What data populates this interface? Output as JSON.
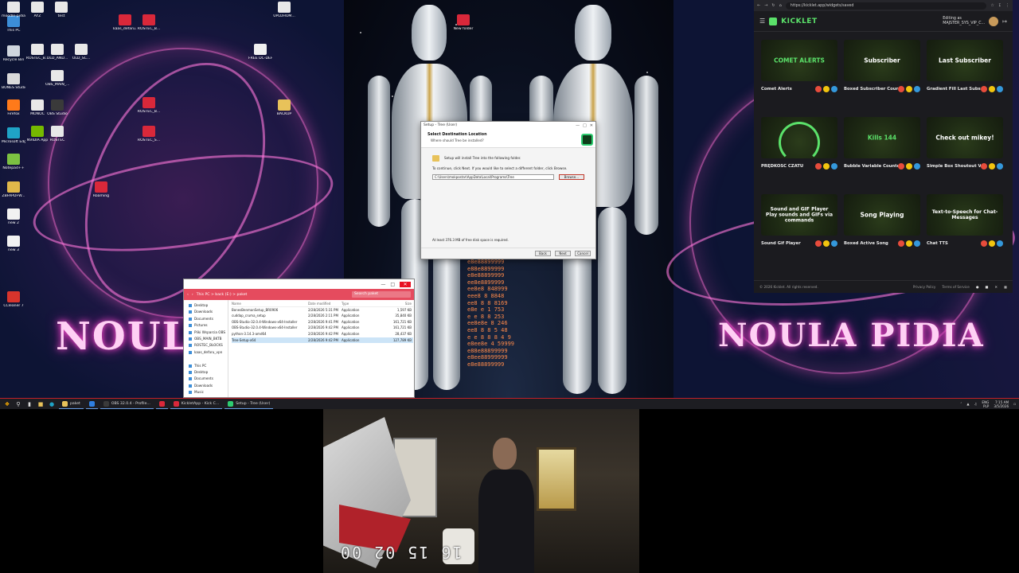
{
  "desktop": {
    "wall_text_left": "NOULA",
    "wall_text_right": "NOULA PIDIA",
    "matrix_lines": [
      "e8e88899999",
      "e88e8899999",
      "e8e88899999",
      "ee8e8899999",
      "ee8e8 848999",
      "eee8 8 8848",
      "ee8 8 8 8169",
      "e8e e 1 753",
      "e e 8 8 253",
      "ee8e8e 8 246",
      "ee8 8 8 5 48",
      "e e 8 8 8 4 9",
      "e8ee8e 4 59999",
      "e88e88899999",
      "e8ee88999999",
      "e8e88899999"
    ],
    "icons": [
      {
        "label": "This PC",
        "color": "#3c8ed8"
      },
      {
        "label": "Recycle Bin",
        "color": "#cfd6de"
      },
      {
        "label": "BONES Studio",
        "color": "#d9d9d9"
      },
      {
        "label": "Firefox",
        "color": "#ff7a1a"
      },
      {
        "label": "Microsoft Edge",
        "color": "#1fa3c6"
      },
      {
        "label": "Notepad++",
        "color": "#7cc242"
      },
      {
        "label": "ZBFAPDFW...",
        "color": "#e0b84a"
      },
      {
        "label": "new 2",
        "color": "#f2f2f2"
      },
      {
        "label": "new 3",
        "color": "#f2f2f2"
      },
      {
        "label": "CCleaner 7",
        "color": "#d8342c"
      },
      {
        "label": "ROSTEC_B...",
        "color": "#e8e8e8"
      },
      {
        "label": "OLD_AND...",
        "color": "#e8e8e8"
      },
      {
        "label": "OLD_SC...",
        "color": "#e8e8e8"
      },
      {
        "label": "OBS_MAIN_...",
        "color": "#e8e8e8"
      },
      {
        "label": "MONOC",
        "color": "#e8e8e8"
      },
      {
        "label": "OBS Studio",
        "color": "#3a3a3a"
      },
      {
        "label": "NVIDIA App",
        "color": "#76b900"
      },
      {
        "label": "ROSTEC",
        "color": "#e8e8e8"
      },
      {
        "label": "kaas_defaru...",
        "color": "#d9283a"
      },
      {
        "label": "ROSTEC_B...",
        "color": "#d9283a"
      },
      {
        "label": "ROSTEC_B...",
        "color": "#d9283a"
      },
      {
        "label": "ROSTEC_S...",
        "color": "#d9283a"
      },
      {
        "label": "Roaming",
        "color": "#d9283a"
      },
      {
        "label": "FREE DC-DEF",
        "color": "#f0f0f0"
      },
      {
        "label": "BACKUP",
        "color": "#e8c25a"
      },
      {
        "label": "New folder",
        "color": "#d9283a"
      },
      {
        "label": "UPLOHOM...",
        "color": "#e8e8e8"
      },
      {
        "label": "moodle-pidia",
        "color": "#e8e8e8"
      },
      {
        "label": "AYZ",
        "color": "#e8e8e8"
      },
      {
        "label": "test",
        "color": "#e8e8e8"
      }
    ]
  },
  "setup": {
    "title": "Setup - Tree (User)",
    "heading": "Select Destination Location",
    "subheading": "Where should Tree be installed?",
    "install_msg": "Setup will install Tree into the following folder.",
    "continue_msg": "To continue, click Next. If you would like to select a different folder, click Browse.",
    "path": "C:\\Users\\mokpostar\\AppData\\Local\\Programs\\Tree",
    "browse_label": "Browse...",
    "space_msg": "At least 376.3 MB of free disk space is required.",
    "back_label": "Back",
    "next_label": "Next",
    "cancel_label": "Cancel"
  },
  "explorer": {
    "crumbs": "This PC  >  back (E:)  >  paket",
    "search_placeholder": "Search paket",
    "sidebar": [
      "Desktop",
      "Downloads",
      "Documents",
      "Pictures",
      "Pliki Wsparcia OBS",
      "OBS_MAIN_BKTB",
      "ROSTEC_BLOCKS",
      "kaas_defaru_vpn",
      "",
      "This PC",
      "Desktop",
      "Documents",
      "Downloads",
      "Music"
    ],
    "headers": {
      "name": "Name",
      "date": "Date modified",
      "type": "Type",
      "size": "Size"
    },
    "files": [
      {
        "name": "BonesBenmanSetup_BR0906",
        "date": "2/28/2026 5:31 PM",
        "type": "Application",
        "size": "1,597 KB"
      },
      {
        "name": "cuddap_cruma_setup",
        "date": "2/28/2026 2:11 PM",
        "type": "Application",
        "size": "35,840 KB"
      },
      {
        "name": "OBS-Studio-32.0.4-Windows-x64-Installer",
        "date": "2/28/2026 9:41 PM",
        "type": "Application",
        "size": "161,721 KB"
      },
      {
        "name": "OBS-Studio-32.0.4-Windows-x64-Installer",
        "date": "2/28/2026 9:42 PM",
        "type": "Application",
        "size": "161,721 KB"
      },
      {
        "name": "python-3.14.3-amd64",
        "date": "2/28/2026 9:42 PM",
        "type": "Application",
        "size": "28,437 KB"
      },
      {
        "name": "Tree-Setup-x64",
        "date": "2/28/2026 9:42 PM",
        "type": "Application",
        "size": "127,789 KB"
      }
    ]
  },
  "browser": {
    "url": "https://kicklet.app/widgets/saved",
    "brand": "KICKLET",
    "editing_as_label": "Editing as",
    "editing_as_user": "MAJSTER_SYS_VIP_C...",
    "widgets": [
      {
        "name": "Comet Alerts",
        "thumb_text": "COMET ALERTS",
        "thumb_color": "#5be16a"
      },
      {
        "name": "Boxed Subscriber Counter",
        "thumb_text": "Subscriber",
        "thumb_color": "#ffffff"
      },
      {
        "name": "Gradient Fill Last Subscriber",
        "thumb_text": "Last Subscriber",
        "thumb_color": "#ffffff"
      },
      {
        "name": "PRĘDKOŚĆ CZATU",
        "thumb_text": "",
        "thumb_color": "#5be16a"
      },
      {
        "name": "Bubble Variable Counter",
        "thumb_text": "Kills 144",
        "thumb_color": "#5be16a"
      },
      {
        "name": "Simple Box Shoutout Visuali...",
        "thumb_text": "Check out mikey!",
        "thumb_color": "#ffffff"
      },
      {
        "name": "Sound Gif Player",
        "thumb_text": "Sound and GIF Player Play sounds and GIFs via commands",
        "thumb_color": "#ffffff"
      },
      {
        "name": "Boxed Active Song",
        "thumb_text": "Song Playing",
        "thumb_color": "#ffffff"
      },
      {
        "name": "Chat TTS",
        "thumb_text": "Text-to-Speech for Chat-Messages",
        "thumb_color": "#ffffff"
      }
    ],
    "footer_copyright": "© 2026 Kicklet. All rights reserved.",
    "footer_privacy": "Privacy Policy",
    "footer_terms": "Terms of Service"
  },
  "taskbar": {
    "apps": [
      {
        "label": "paket",
        "color": "#e8c25a"
      },
      {
        "label": "",
        "color": "#2f7fe0"
      },
      {
        "label": "OBS 32.0.4 - Profile...",
        "color": "#3a3a3a"
      },
      {
        "label": "",
        "color": "#d9283a"
      },
      {
        "label": "KickletApp - Kick C...",
        "color": "#d9283a"
      },
      {
        "label": "Setup - Tree (User)",
        "color": "#2ecc71"
      }
    ],
    "lang": "ENG",
    "lang2": "PLP",
    "time": "7:15 AM",
    "date": "3/5/2026"
  },
  "webcam": {
    "timestamp": "16 15 02 00"
  },
  "colors": {
    "kicklet_green": "#5be16a",
    "taskbar_red": "#c0202a",
    "explorer_accent": "#e54b5e"
  }
}
